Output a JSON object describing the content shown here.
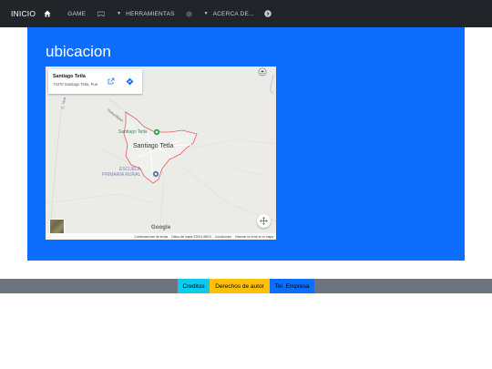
{
  "navbar": {
    "brand": "INICIO",
    "home_icon": "home-icon",
    "items": [
      {
        "label": "GAME",
        "icon": "gamepad-icon"
      },
      {
        "label": "HERRAMIENTAS",
        "icon": "gear-icon"
      },
      {
        "label": "ACERCA DE...",
        "icon": "info-circle-icon"
      }
    ]
  },
  "main": {
    "title": "ubicacion"
  },
  "map": {
    "place_name": "Santiago Tetla",
    "place_address": "74370 Santiago Tetla, Pue.",
    "labels": {
      "town": "Santiago Tetla",
      "marker_name": "Santiago Tetla",
      "school_line1": "ESCUELA",
      "school_line2": "PRIMARIA RURAL",
      "road1": "Hueyotlipan",
      "road2": "C. Viva",
      "google": "Google"
    },
    "attribution": [
      "Combinaciones de teclas",
      "Datos del mapa ©2024 INEGI",
      "Condiciones",
      "Informar un error en el mapa"
    ]
  },
  "footer": {
    "creditos": "Creditos",
    "derechos": "Derechos de autor",
    "tel": "Tel. Empresa"
  },
  "colors": {
    "navbar_bg": "#212529",
    "hero_bg": "#0d6efd",
    "footer_bg": "#6c757d",
    "info": "#0dcaf0",
    "warning": "#ffc107",
    "primary": "#0d6efd"
  }
}
